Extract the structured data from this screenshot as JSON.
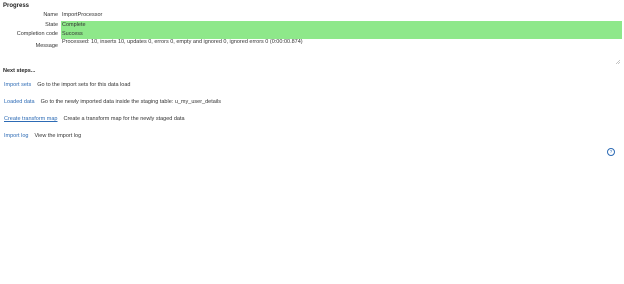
{
  "progress": {
    "title": "Progress",
    "fields": {
      "name_label": "Name",
      "name_value": "ImportProcessor",
      "state_label": "State",
      "state_value": "Complete",
      "completion_label": "Completion code",
      "completion_value": "Success",
      "message_label": "Message",
      "message_value": "Processed: 10, inserts 10, updates 0, errors 0, empty and ignored 0, ignored errors 0  (0:00:00.874)"
    },
    "status_color": "#8ee88a"
  },
  "next_steps": {
    "title": "Next steps...",
    "items": [
      {
        "link": "Import sets",
        "description": "Go to the import sets for this data load"
      },
      {
        "link": "Loaded data",
        "description": "Go to the newly imported data inside the staging table: u_my_user_details"
      },
      {
        "link": "Create transform map",
        "description": "Create a transform map for the newly staged data"
      },
      {
        "link": "Import log",
        "description": "View the import log"
      }
    ]
  },
  "icons": {
    "help": "help-circle-icon",
    "resize": "resize-grip-icon"
  },
  "help_glyph": "?"
}
